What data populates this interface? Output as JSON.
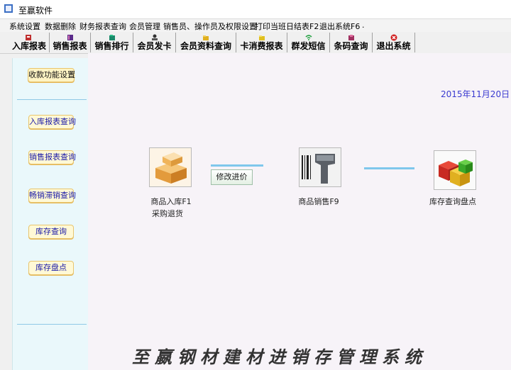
{
  "window": {
    "title": "至嬴软件",
    "icon": "app-icon"
  },
  "menu": [
    "系统设置",
    "数据删除",
    "财务报表查询",
    "会员管理",
    "销售员、操作员及权限设置",
    "打印当班日结表F2",
    "退出系统F6",
    "."
  ],
  "toolbar": [
    {
      "label": "入库报表",
      "icon": "inbound-report-icon",
      "color": "#c03030"
    },
    {
      "label": "销售报表",
      "icon": "sales-report-icon",
      "color": "#5a2a8a"
    },
    {
      "label": "销售排行",
      "icon": "ranking-icon",
      "color": "#1a8a6a"
    },
    {
      "label": "会员发卡",
      "icon": "member-card-icon",
      "color": "#333333"
    },
    {
      "label": "会员资料查询",
      "icon": "folder-icon",
      "color": "#e0b020"
    },
    {
      "label": "卡消费报表",
      "icon": "card-report-icon",
      "color": "#e0c020"
    },
    {
      "label": "群发短信",
      "icon": "wifi-icon",
      "color": "#20a040"
    },
    {
      "label": "条码查询",
      "icon": "barcode-icon",
      "color": "#a03060"
    },
    {
      "label": "退出系统",
      "icon": "exit-icon",
      "color": "#d02020"
    }
  ],
  "sidebar": [
    "收款功能设置",
    "入库报表查询",
    "销售报表查询",
    "畅销滞销查询",
    "库存查询",
    "库存盘点"
  ],
  "date": "2015年11月20日",
  "modules": {
    "inbound": {
      "line1": "商品入库F1",
      "line2": "采购退货"
    },
    "edit_price": "修改进价",
    "sales": "商品销售F9",
    "inventory": "库存查询盘点"
  },
  "footer_title": "至嬴钢材建材进销存管理系统"
}
